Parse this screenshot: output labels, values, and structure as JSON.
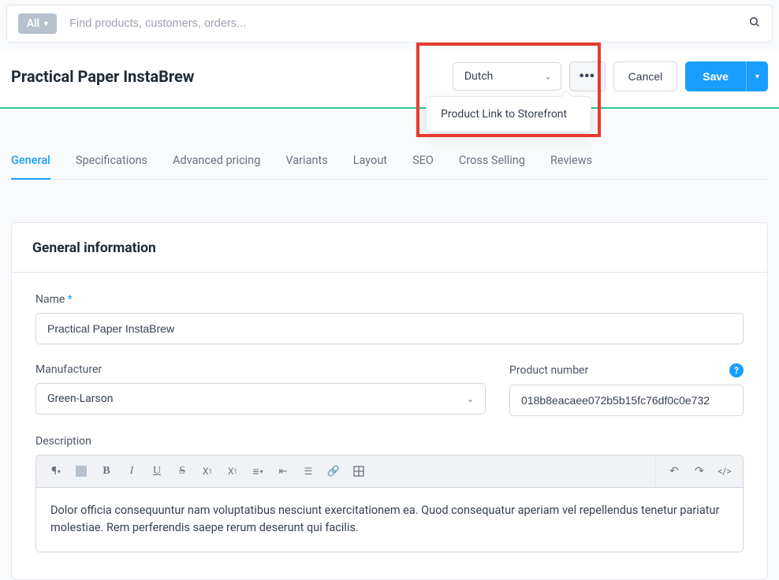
{
  "search": {
    "all_label": "All",
    "placeholder": "Find products, customers, orders..."
  },
  "header": {
    "title": "Practical Paper InstaBrew",
    "language": "Dutch",
    "cancel_label": "Cancel",
    "save_label": "Save",
    "popover_text": "Product Link to Storefront"
  },
  "tabs": [
    "General",
    "Specifications",
    "Advanced pricing",
    "Variants",
    "Layout",
    "SEO",
    "Cross Selling",
    "Reviews"
  ],
  "card": {
    "title": "General information",
    "name_label": "Name",
    "name_value": "Practical Paper InstaBrew",
    "manufacturer_label": "Manufacturer",
    "manufacturer_value": "Green-Larson",
    "product_number_label": "Product number",
    "product_number_value": "018b8eacaee072b5b15fc76df0c0e732",
    "description_label": "Description",
    "description_value": "Dolor officia consequuntur nam voluptatibus nesciunt exercitationem ea. Quod consequatur aperiam vel repellendus tenetur pariatur molestiae. Rem perferendis saepe rerum deserunt qui facilis."
  }
}
